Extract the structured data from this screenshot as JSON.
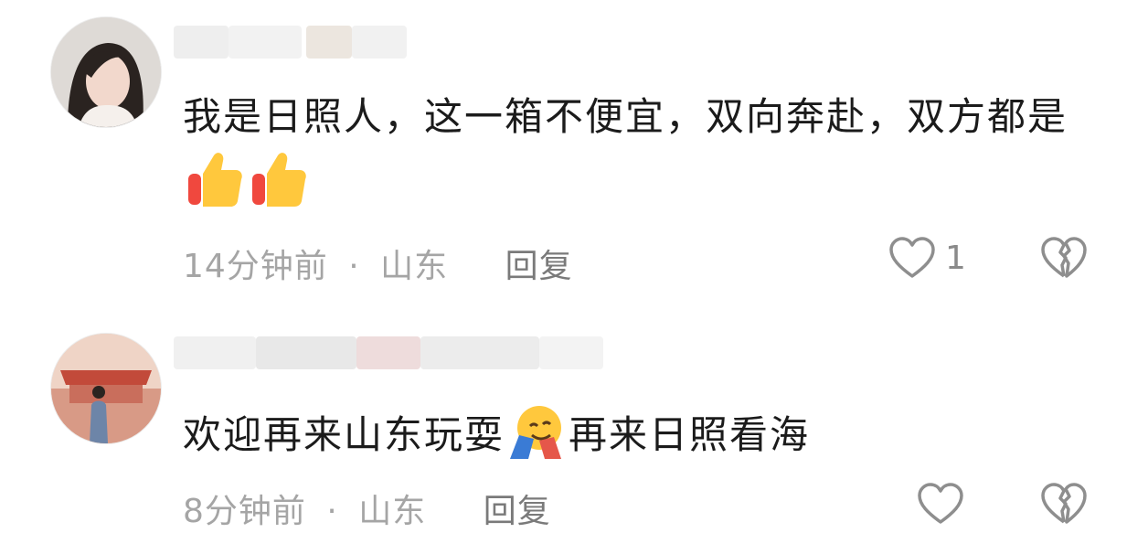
{
  "comments": [
    {
      "text": "我是日照人，这一箱不便宜，双向奔赴，双方都是",
      "emojis": [
        "thumbs-up",
        "thumbs-up"
      ],
      "time": "14分钟前",
      "separator": "·",
      "location": "山东",
      "reply_label": "回复",
      "like_count": "1"
    },
    {
      "text_before": "欢迎再来山东玩耍",
      "emoji": "hugging-face",
      "text_after": "再来日照看海",
      "time": "8分钟前",
      "separator": "·",
      "location": "山东",
      "reply_label": "回复",
      "like_count": ""
    }
  ],
  "colors": {
    "meta_text": "#a5a5a5",
    "reply_text": "#7a7a7a",
    "icon_stroke": "#8e8e8e",
    "comment_text": "#1b1b1b"
  }
}
